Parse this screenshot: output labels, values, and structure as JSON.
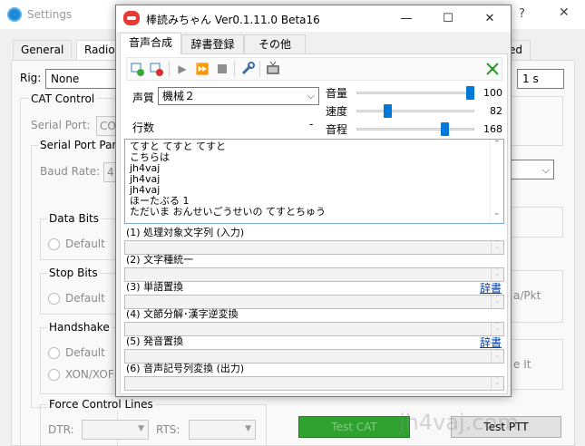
{
  "settings": {
    "title": "Settings",
    "help": "?",
    "close": "✕",
    "tabs": [
      {
        "label": "General"
      },
      {
        "label": "Radio"
      },
      {
        "label": "ed"
      }
    ],
    "rig_label": "Rig:",
    "rig_value": "None",
    "cat_control": "CAT Control",
    "serial_port_label": "Serial Port:",
    "serial_port_value": "CO",
    "serial_port_params": "Serial Port Par",
    "baud_rate_label": "Baud Rate:",
    "baud_rate_value": "4",
    "data_bits": "Data Bits",
    "data_bits_default": "Default",
    "stop_bits": "Stop Bits",
    "stop_bits_default": "Default",
    "handshake": "Handshake",
    "handshake_default": "Default",
    "handshake_xon": "XON/XOF",
    "force_control_lines": "Force Control Lines",
    "dtr_label": "DTR:",
    "rts_label": "RTS:",
    "poll_value": "1 s",
    "pkt_text": "a/Pkt",
    "e_it_text": "e It",
    "test_cat": "Test CAT",
    "test_ptt": "Test PTT",
    "watermark": "jh4vaj.com",
    "accent": "#1e8ad6",
    "test_cat_color": "#2ea12e"
  },
  "app": {
    "title": "棒読みちゃん Ver0.1.11.0 Beta16",
    "title_color": "#e53935",
    "window_buttons": {
      "minimize": "—",
      "maximize": "☐",
      "close": "✕"
    },
    "tabs": [
      {
        "label": "音声合成"
      },
      {
        "label": "辞書登録"
      },
      {
        "label": "その他"
      }
    ],
    "toolbar": {
      "icons": [
        "add-clip-icon",
        "remove-clip-icon",
        "play-icon",
        "fast-forward-icon",
        "stop-icon",
        "wrench-icon",
        "tv-icon",
        "arrows-icon"
      ]
    },
    "voice": {
      "label": "声質",
      "value": "機械２"
    },
    "lines_label": "行数",
    "lines_value": "-",
    "sliders": {
      "volume": {
        "label": "音量",
        "value": "100",
        "fraction": 1.0
      },
      "speed": {
        "label": "速度",
        "value": "82",
        "fraction": 0.25
      },
      "pitch": {
        "label": "音程",
        "value": "168",
        "fraction": 0.77
      }
    },
    "text_lines": [
      "てすと てすと てすと",
      "こちらは",
      "jh4vaj",
      "jh4vaj",
      "jh4vaj",
      "ほーたぶる 1",
      "ただいま おんせいごうせいの てすとちゅう"
    ],
    "stages": [
      {
        "label": "(1) 処理対象文字列 (入力)",
        "link": ""
      },
      {
        "label": "(2) 文字種統一",
        "link": ""
      },
      {
        "label": "(3) 単語置換",
        "link": "辞書"
      },
      {
        "label": "(4) 文節分解･漢字逆変換",
        "link": ""
      },
      {
        "label": "(5) 発音置換",
        "link": "辞書"
      },
      {
        "label": "(6) 音声記号列変換 (出力)",
        "link": ""
      }
    ]
  }
}
